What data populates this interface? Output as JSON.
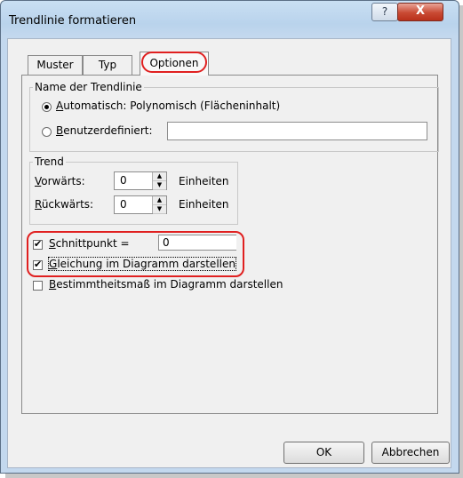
{
  "window": {
    "title": "Trendlinie formatieren",
    "help_glyph": "?",
    "close_glyph": "X"
  },
  "tabs": [
    {
      "label": "Muster",
      "selected": false
    },
    {
      "label": "Typ",
      "selected": false
    },
    {
      "label": "Optionen",
      "selected": true
    }
  ],
  "name_group": {
    "legend": "Name der Trendlinie",
    "auto": {
      "accel": "A",
      "rest": "utomatisch: Polynomisch (Flächeninhalt)",
      "checked": true
    },
    "custom": {
      "accel": "B",
      "rest": "enutzerdefiniert:",
      "checked": false,
      "value": ""
    }
  },
  "trend_group": {
    "legend": "Trend",
    "forward": {
      "accel": "V",
      "rest": "orwärts:",
      "value": "0",
      "unit": "Einheiten"
    },
    "backward": {
      "accel": "R",
      "rest": "ückwärts:",
      "value": "0",
      "unit": "Einheiten"
    }
  },
  "options": {
    "intercept": {
      "accel": "S",
      "rest": "chnittpunkt =",
      "checked": true,
      "value": "0"
    },
    "equation": {
      "accel": "G",
      "rest": "leichung im Diagramm darstellen",
      "checked": true
    },
    "rsquared": {
      "accel": "B",
      "rest": "estimmtheitsmaß im Diagramm darstellen",
      "checked": false
    }
  },
  "buttons": {
    "ok": "OK",
    "cancel": "Abbrechen"
  },
  "check_glyph": "✔",
  "spin_up": "▲",
  "spin_down": "▼"
}
